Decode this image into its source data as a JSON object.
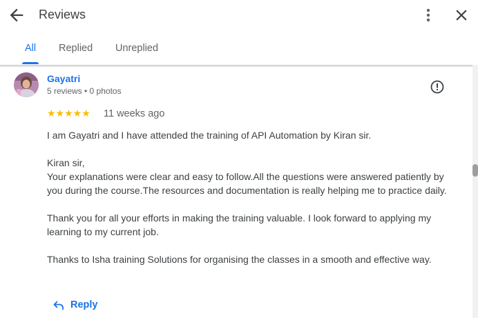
{
  "header": {
    "title": "Reviews",
    "back_icon": "arrow-left-icon",
    "more_icon": "more-vert-icon",
    "close_icon": "close-icon"
  },
  "tabs": [
    {
      "label": "All",
      "active": true
    },
    {
      "label": "Replied",
      "active": false
    },
    {
      "label": "Unreplied",
      "active": false
    }
  ],
  "review": {
    "reviewer": "Gayatri",
    "meta": "5 reviews • 0 photos",
    "rating": 5,
    "stars": "★★★★★",
    "time": "11 weeks ago",
    "paragraphs": [
      "I am Gayatri and I have attended the training of API Automation by Kiran sir.",
      "Kiran sir,\nYour explanations were clear and easy to follow.All the questions were answered patiently by you during the course.The resources and documentation is really helping me to practice daily.",
      "Thank you for all your efforts in making the training valuable. I look forward to applying my learning to my current job.",
      "Thanks to Isha training Solutions for organising the classes in a smooth and effective way."
    ]
  },
  "reply": {
    "label": "Reply",
    "icon": "reply-icon"
  },
  "colors": {
    "accent": "#1a73e8",
    "star": "#fbbc04",
    "text": "#3c4043",
    "secondary_text": "#5f6368"
  }
}
